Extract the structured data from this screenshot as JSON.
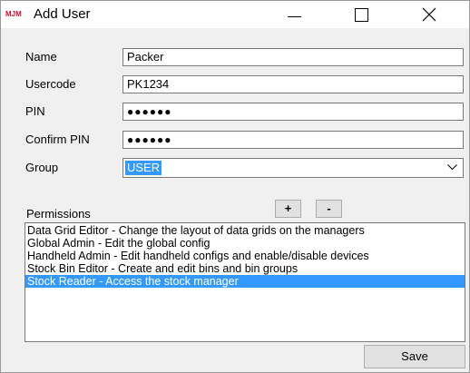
{
  "window": {
    "logo_text": "MJM",
    "title": "Add User"
  },
  "form": {
    "name": {
      "label": "Name",
      "value": "Packer"
    },
    "usercode": {
      "label": "Usercode",
      "value": "PK1234"
    },
    "pin": {
      "label": "PIN",
      "value": "●●●●●●"
    },
    "confirm_pin": {
      "label": "Confirm PIN",
      "value": "●●●●●●"
    },
    "group": {
      "label": "Group",
      "value": "USER"
    }
  },
  "permissions": {
    "label": "Permissions",
    "add_label": "+",
    "remove_label": "-",
    "items": [
      {
        "text": "Data Grid Editor - Change the layout of data grids on the managers",
        "selected": false
      },
      {
        "text": "Global Admin - Edit the global config",
        "selected": false
      },
      {
        "text": "Handheld Admin - Edit handheld configs and enable/disable devices",
        "selected": false
      },
      {
        "text": "Stock Bin Editor - Create and edit bins and bin groups",
        "selected": false
      },
      {
        "text": "Stock Reader - Access the stock manager",
        "selected": true
      }
    ]
  },
  "footer": {
    "save_label": "Save"
  },
  "colors": {
    "selection": "#3399ff",
    "logo": "#c8102e"
  }
}
